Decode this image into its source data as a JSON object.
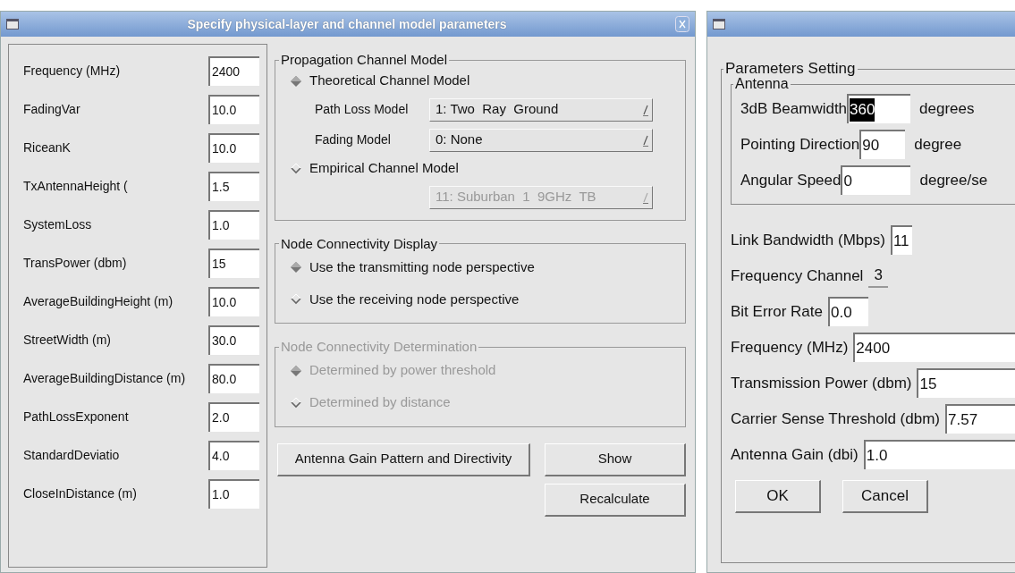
{
  "main_window": {
    "title": "Specify physical-layer and channel model parameters",
    "parameters": [
      {
        "label": "Frequency (MHz)",
        "value": "2400"
      },
      {
        "label": "FadingVar",
        "value": "10.0"
      },
      {
        "label": "RiceanK",
        "value": "10.0"
      },
      {
        "label": "TxAntennaHeight (",
        "value": "1.5"
      },
      {
        "label": "SystemLoss",
        "value": "1.0"
      },
      {
        "label": "TransPower (dbm)",
        "value": "15"
      },
      {
        "label": "AverageBuildingHeight (m)",
        "value": "10.0"
      },
      {
        "label": "StreetWidth (m)",
        "value": "30.0"
      },
      {
        "label": "AverageBuildingDistance (m)",
        "value": "80.0"
      },
      {
        "label": "PathLossExponent",
        "value": "2.0"
      },
      {
        "label": "StandardDeviatio",
        "value": "4.0"
      },
      {
        "label": "CloseInDistance (m)",
        "value": "1.0"
      }
    ],
    "propagation": {
      "title": "Propagation Channel Model",
      "disabled": false,
      "options": [
        {
          "label": "Theoretical Channel Model",
          "selected": true,
          "menus": [
            {
              "label": "Path Loss Model",
              "value": "1: Two  Ray  Ground",
              "disabled": false
            },
            {
              "label": "Fading Model",
              "value": "0: None",
              "disabled": false
            }
          ]
        },
        {
          "label": "Empirical Channel Model",
          "selected": false,
          "menus": [
            {
              "value": "11: Suburban  1  9GHz  TB",
              "disabled": true
            }
          ]
        }
      ]
    },
    "display": {
      "title": "Node Connectivity Display",
      "disabled": false,
      "options": [
        {
          "label": "Use the transmitting node perspective",
          "selected": true
        },
        {
          "label": "Use the receiving node perspective",
          "selected": false
        }
      ]
    },
    "determination": {
      "title": "Node Connectivity Determination",
      "disabled": true,
      "options": [
        {
          "label": "Determined by power threshold",
          "selected": true
        },
        {
          "label": "Determined by distance",
          "selected": false
        }
      ]
    },
    "buttons": [
      {
        "label": "Antenna Gain Pattern and Directivity"
      },
      {
        "label": "Show"
      },
      {
        "label": "Recalculate"
      }
    ]
  },
  "settings_window": {
    "group_title": "Parameters Setting",
    "antenna": {
      "title": "Antenna",
      "fields": [
        {
          "label": "3dB Beamwidth",
          "value": "360",
          "unit": "degrees",
          "highlighted": true
        },
        {
          "label": "Pointing Direction",
          "value": "90",
          "unit": "degree",
          "highlighted": false
        },
        {
          "label": "Angular Speed",
          "value": "0",
          "unit": "degree/se",
          "highlighted": false
        }
      ]
    },
    "fields": [
      {
        "kind": "entry",
        "label": "Link Bandwidth (Mbps)",
        "value": "11"
      },
      {
        "kind": "label",
        "label": "Frequency Channel",
        "value": "3"
      },
      {
        "kind": "entry",
        "label": "Bit Error Rate",
        "value": "0.0"
      },
      {
        "kind": "entry",
        "label": "Frequency (MHz)",
        "value": "2400"
      },
      {
        "kind": "entry",
        "label": "Transmission Power (dbm)",
        "value": "15"
      },
      {
        "kind": "entry",
        "label": "Carrier Sense Threshold (dbm)",
        "value": "7.57"
      },
      {
        "kind": "entry",
        "label": "Antenna Gain (dbi)",
        "value": "1.0"
      }
    ],
    "buttons": [
      {
        "label": "OK"
      },
      {
        "label": "Cancel"
      }
    ]
  }
}
